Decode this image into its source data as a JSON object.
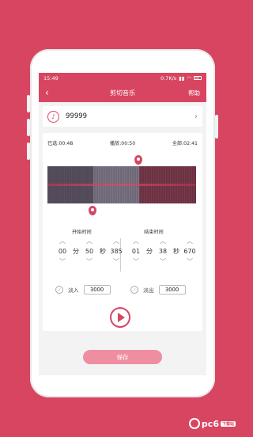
{
  "statusbar": {
    "time": "15:49",
    "network": "0.7K/s",
    "battery": "battery-icon"
  },
  "titlebar": {
    "title": "剪切音乐",
    "help": "帮助",
    "back_icon": "back-arrow-icon"
  },
  "song": {
    "name": "99999",
    "icon": "music-note-icon"
  },
  "timing": {
    "selected": "已选:00:48",
    "playing": "播放:00:50",
    "total": "全部:02:41"
  },
  "start": {
    "title": "开始时间",
    "minutes": "00",
    "min_unit": "分",
    "seconds": "50",
    "sec_unit": "秒",
    "millis": "385"
  },
  "end": {
    "title": "结束时间",
    "minutes": "01",
    "min_unit": "分",
    "seconds": "38",
    "sec_unit": "秒",
    "millis": "670"
  },
  "fade_in": {
    "label": "淡入",
    "value": "3000"
  },
  "fade_out": {
    "label": "淡出",
    "value": "3000"
  },
  "save_label": "保存",
  "watermark": {
    "text": "pc6",
    "sub": "下载站"
  },
  "colors": {
    "accent": "#d84561"
  }
}
